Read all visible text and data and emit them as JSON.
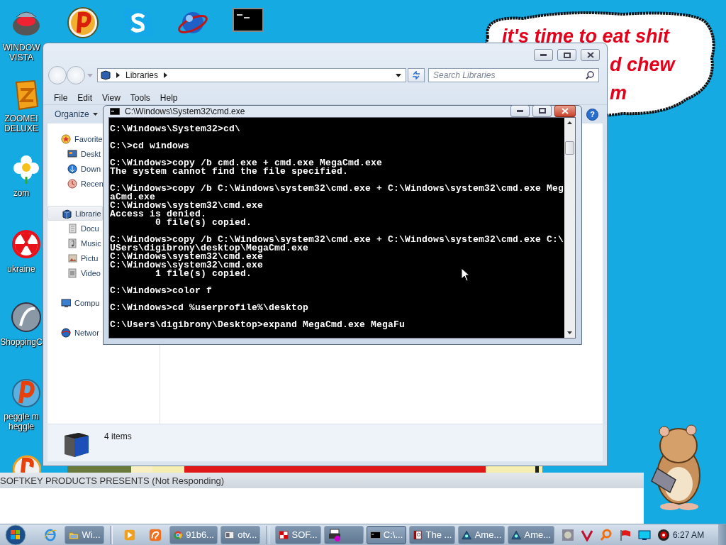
{
  "desktop_icons": [
    {
      "label_lines": [
        "WINDOW",
        "VISTA"
      ]
    },
    {
      "label_lines": [
        "ZOOMEI",
        "DELUXE"
      ]
    },
    {
      "label_lines": [
        "zom"
      ]
    },
    {
      "label_lines": [
        "ukraine"
      ]
    },
    {
      "label_lines": [
        "ShoppingC"
      ]
    },
    {
      "label_lines": [
        "peggle m",
        "heggle"
      ]
    }
  ],
  "speech_bubble": {
    "lines": [
      "it's time to eat shit",
      "d chew",
      "m"
    ]
  },
  "explorer": {
    "address": {
      "crumbs": [
        "Libraries"
      ]
    },
    "search": {
      "placeholder": "Search Libraries"
    },
    "menu": [
      "File",
      "Edit",
      "View",
      "Tools",
      "Help"
    ],
    "toolbar": {
      "organize": "Organize",
      "help": "?"
    },
    "nav": [
      {
        "label": "Favorite",
        "selected": false,
        "children": [
          {
            "label": "Deskt",
            "selected": false
          },
          {
            "label": "Down",
            "selected": false
          },
          {
            "label": "Recen",
            "selected": false
          }
        ]
      },
      {
        "label": "Librarie",
        "selected": true,
        "children": [
          {
            "label": "Docu",
            "selected": false
          },
          {
            "label": "Music",
            "selected": false
          },
          {
            "label": "Pictu",
            "selected": false
          },
          {
            "label": "Video",
            "selected": false
          }
        ]
      },
      {
        "label": "Compu",
        "selected": false
      },
      {
        "label": "Networ",
        "selected": false
      }
    ],
    "details": {
      "summary": "4 items"
    }
  },
  "cmd": {
    "title": "C:\\Windows\\System32\\cmd.exe",
    "blocks": [
      [
        "C:\\Windows\\System32>cd\\"
      ],
      [
        "C:\\>cd windows"
      ],
      [
        "C:\\Windows>copy /b cmd.exe + cmd.exe MegaCmd.exe",
        "The system cannot find the file specified."
      ],
      [
        "C:\\Windows>copy /b C:\\Windows\\system32\\cmd.exe + C:\\Windows\\system32\\cmd.exe Meg",
        "aCmd.exe",
        "C:\\Windows\\system32\\cmd.exe",
        "Access is denied.",
        "        0 file(s) copied."
      ],
      [
        "C:\\Windows>copy /b C:\\Windows\\system32\\cmd.exe + C:\\Windows\\system32\\cmd.exe C:\\",
        "USers\\digibrony\\desktop\\MegaCmd.exe",
        "C:\\Windows\\system32\\cmd.exe",
        "C:\\Windows\\system32\\cmd.exe",
        "        1 file(s) copied."
      ],
      [
        "C:\\Windows>color f"
      ],
      [
        "C:\\Windows>cd %userprofile%\\desktop"
      ],
      [
        "C:\\Users\\digibrony\\Desktop>expand MegaCmd.exe MegaFu"
      ]
    ]
  },
  "softkey": {
    "title": "SOFTKEY PRODUCTS PRESENTS (Not Responding)"
  },
  "taskbar": {
    "items": [
      {
        "kind": "start"
      },
      {
        "kind": "pinned"
      },
      {
        "kind": "button",
        "label": "Wi...",
        "selected": false
      },
      {
        "kind": "separator"
      },
      {
        "kind": "pinned"
      },
      {
        "kind": "pinned"
      },
      {
        "kind": "button",
        "label": "91b6...",
        "selected": false
      },
      {
        "kind": "button",
        "label": "otv...",
        "selected": false
      },
      {
        "kind": "separator"
      },
      {
        "kind": "button",
        "label": "SOF...",
        "selected": false
      },
      {
        "kind": "button",
        "selected": false
      },
      {
        "kind": "button",
        "label": "C:\\...",
        "selected": true
      },
      {
        "kind": "button",
        "label": "The ...",
        "selected": false
      },
      {
        "kind": "button",
        "label": "Ame...",
        "selected": false
      },
      {
        "kind": "button",
        "label": "Ame...",
        "selected": false
      }
    ],
    "clock": "6:27 AM"
  }
}
